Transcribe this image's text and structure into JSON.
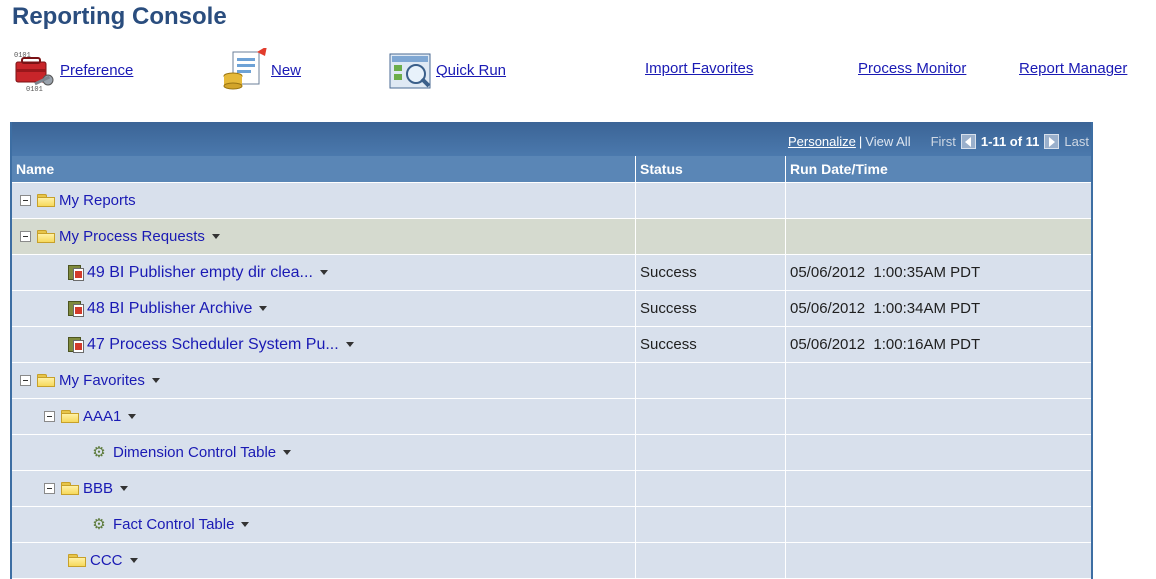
{
  "page": {
    "title": "Reporting Console"
  },
  "toolbar": {
    "preference_label": "Preference",
    "new_label": "New",
    "quick_run_label": "Quick Run",
    "import_favorites_label": "Import Favorites",
    "process_monitor_label": "Process Monitor",
    "report_manager_label": "Report Manager"
  },
  "grid": {
    "nav": {
      "personalize": "Personalize",
      "separator": "|",
      "view_all": "View All",
      "first": "First",
      "count": "1-11 of 11",
      "last": "Last"
    },
    "columns": {
      "name": "Name",
      "status": "Status",
      "run_datetime": "Run Date/Time"
    },
    "rows": [
      {
        "type": "folder",
        "name": "My Reports",
        "status": "",
        "run": ""
      },
      {
        "type": "folder",
        "name": "My Process Requests",
        "status": "",
        "run": ""
      },
      {
        "type": "report",
        "name": "49 BI Publisher empty dir clea...",
        "status": "Success",
        "run": "05/06/2012  1:00:35AM PDT"
      },
      {
        "type": "report",
        "name": "48 BI Publisher Archive",
        "status": "Success",
        "run": "05/06/2012  1:00:34AM PDT"
      },
      {
        "type": "report",
        "name": "47 Process Scheduler System Pu...",
        "status": "Success",
        "run": "05/06/2012  1:00:16AM PDT"
      },
      {
        "type": "folder",
        "name": "My Favorites",
        "status": "",
        "run": ""
      },
      {
        "type": "folder",
        "name": "AAA1",
        "status": "",
        "run": ""
      },
      {
        "type": "favorite",
        "name": "Dimension Control Table",
        "status": "",
        "run": ""
      },
      {
        "type": "folder",
        "name": "BBB",
        "status": "",
        "run": ""
      },
      {
        "type": "favorite",
        "name": "Fact Control Table",
        "status": "",
        "run": ""
      },
      {
        "type": "folder",
        "name": "CCC",
        "status": "",
        "run": ""
      }
    ]
  },
  "icons": {
    "preference": "toolbox-icon",
    "new": "new-report-icon",
    "quick_run": "quick-run-icon",
    "folder": "folder-icon",
    "report": "report-icon",
    "favorite": "gear-icon"
  },
  "colors": {
    "title": "#2a4d7e",
    "link": "#1a1ab4",
    "nav_bar": "#3b6496",
    "header": "#5a86b6",
    "row_blue": "#d8e0ec",
    "row_highlight": "#d5dacf"
  }
}
